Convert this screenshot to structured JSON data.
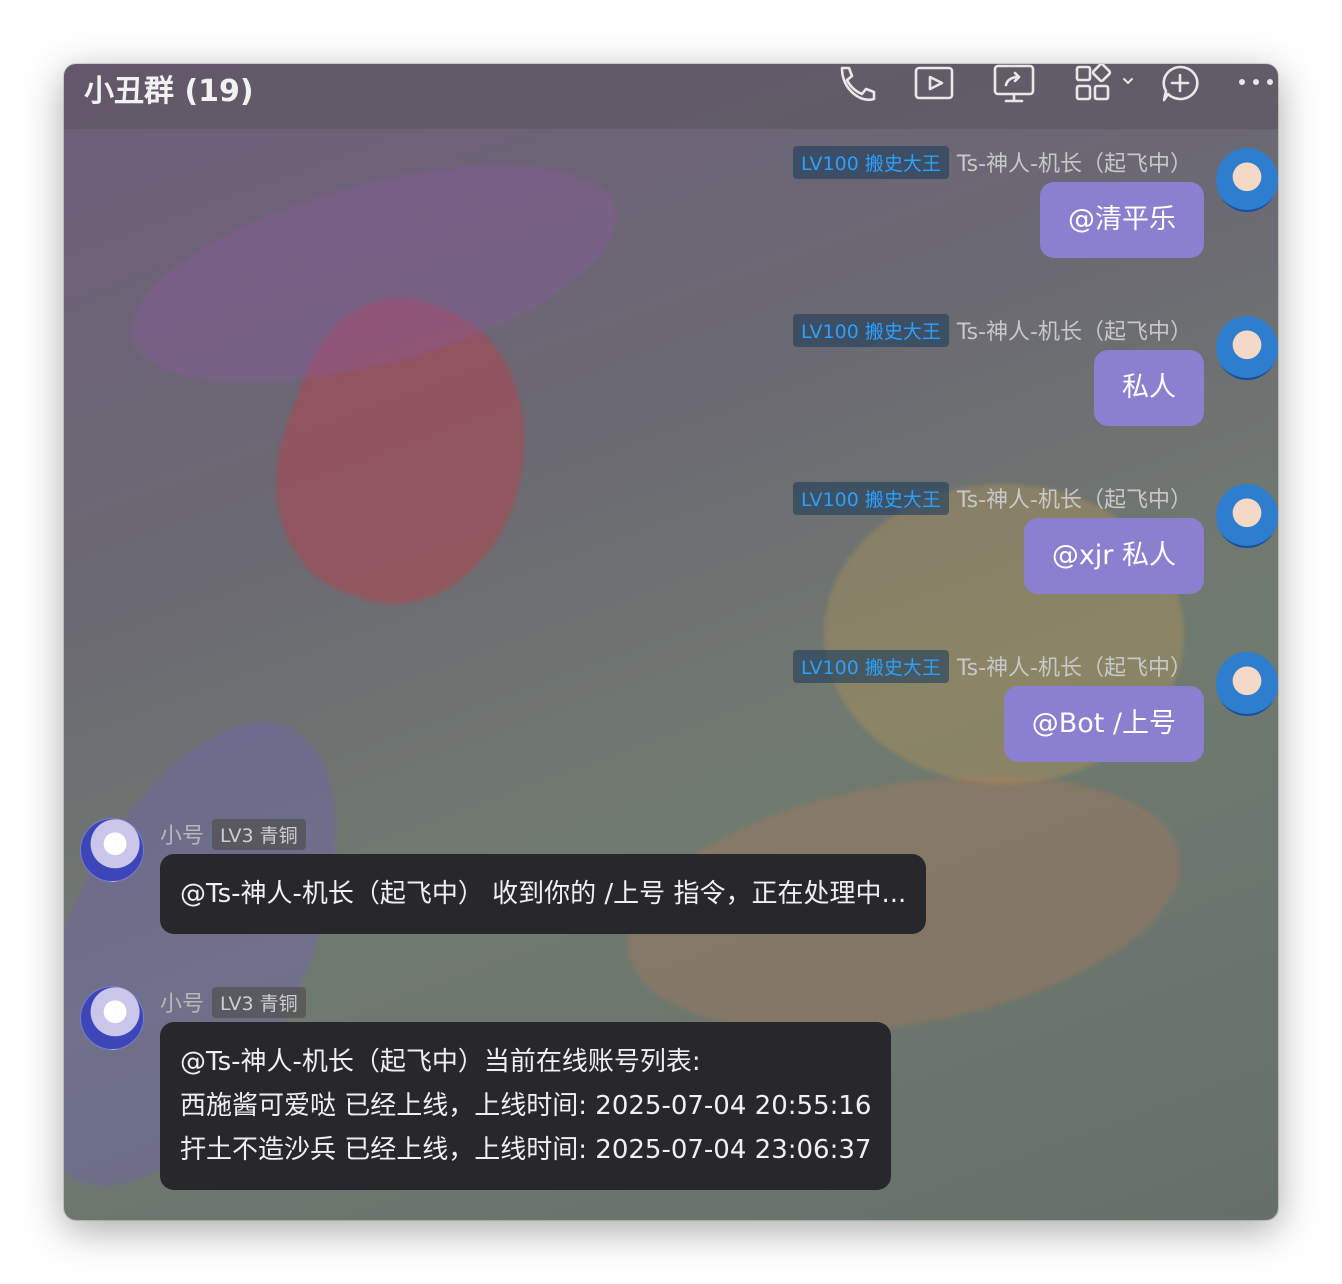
{
  "header": {
    "title": "小丑群 (19)",
    "icons": [
      "phone-icon",
      "video-camera-icon",
      "screen-share-icon",
      "apps-grid-icon",
      "add-chat-icon",
      "more-icon"
    ]
  },
  "colors": {
    "my_bubble": "#8b7fd0",
    "other_bubble": "#27272c",
    "lv100_badge_text": "#2aa0ff"
  },
  "messages_out": [
    {
      "badge": "LV100 搬史大王",
      "sender": "Ts-神人-机长（起飞中）",
      "text": "@清平乐"
    },
    {
      "badge": "LV100 搬史大王",
      "sender": "Ts-神人-机长（起飞中）",
      "text": "私人"
    },
    {
      "badge": "LV100 搬史大王",
      "sender": "Ts-神人-机长（起飞中）",
      "text": "@xjr 私人"
    },
    {
      "badge": "LV100 搬史大王",
      "sender": "Ts-神人-机长（起飞中）",
      "text": "@Bot /上号"
    }
  ],
  "messages_in": [
    {
      "sender": "小号",
      "badge": "LV3 青铜",
      "lines": [
        "@Ts-神人-机长（起飞中） 收到你的 /上号 指令，正在处理中..."
      ]
    },
    {
      "sender": "小号",
      "badge": "LV3 青铜",
      "lines": [
        "@Ts-神人-机长（起飞中）当前在线账号列表:",
        "西施酱可爱哒  已经上线，上线时间: 2025-07-04 20:55:16",
        "扞土不造沙兵  已经上线，上线时间: 2025-07-04 23:06:37"
      ]
    }
  ]
}
